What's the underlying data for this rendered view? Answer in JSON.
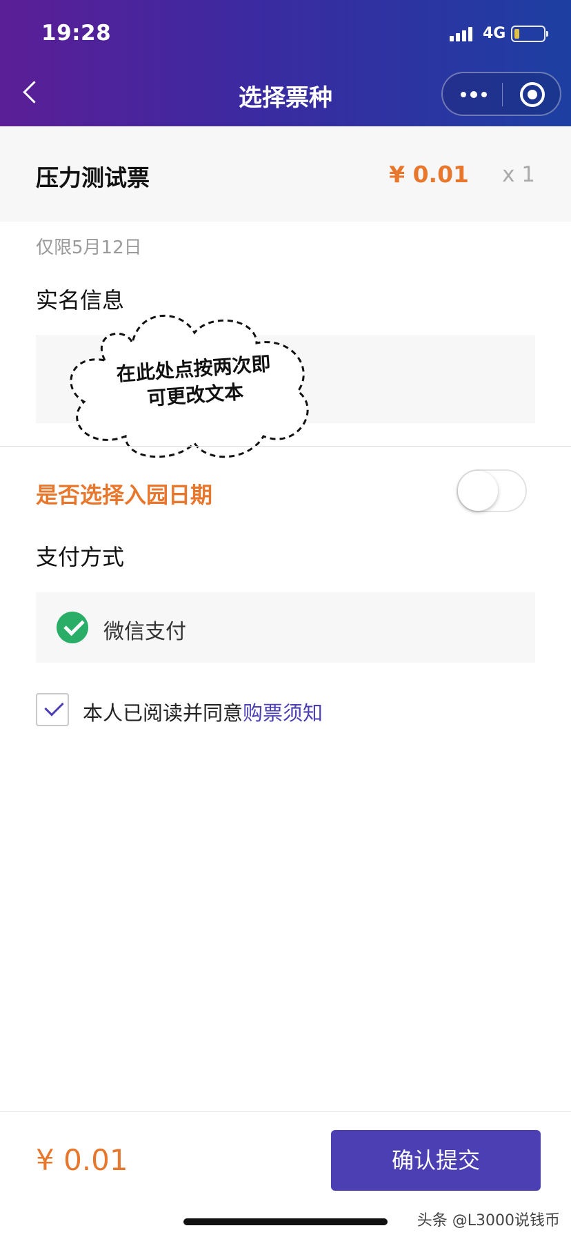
{
  "status_bar": {
    "time": "19:28",
    "network": "4G"
  },
  "nav": {
    "title": "选择票种"
  },
  "ticket": {
    "name": "压力测试票",
    "price": "¥ 0.01",
    "quantity": "x 1"
  },
  "date_limit": "仅限5月12日",
  "real_name": {
    "section_title": "实名信息"
  },
  "overlay_note": {
    "line1": "在此处点按两次即",
    "line2": "可更改文本"
  },
  "park_date": {
    "label": "是否选择入园日期",
    "enabled": false
  },
  "payment": {
    "section_title": "支付方式",
    "method": "微信支付"
  },
  "agreement": {
    "text": "本人已阅读并同意",
    "link": "购票须知",
    "checked": true
  },
  "footer": {
    "total": "¥  0.01",
    "submit_label": "确认提交"
  },
  "watermark": "头条 @L3000说钱币",
  "colors": {
    "accent": "#e8772e",
    "primary": "#4b3fb3",
    "header_start": "#5b1e96",
    "header_end": "#1d3fa2",
    "wechat": "#2aae67"
  }
}
